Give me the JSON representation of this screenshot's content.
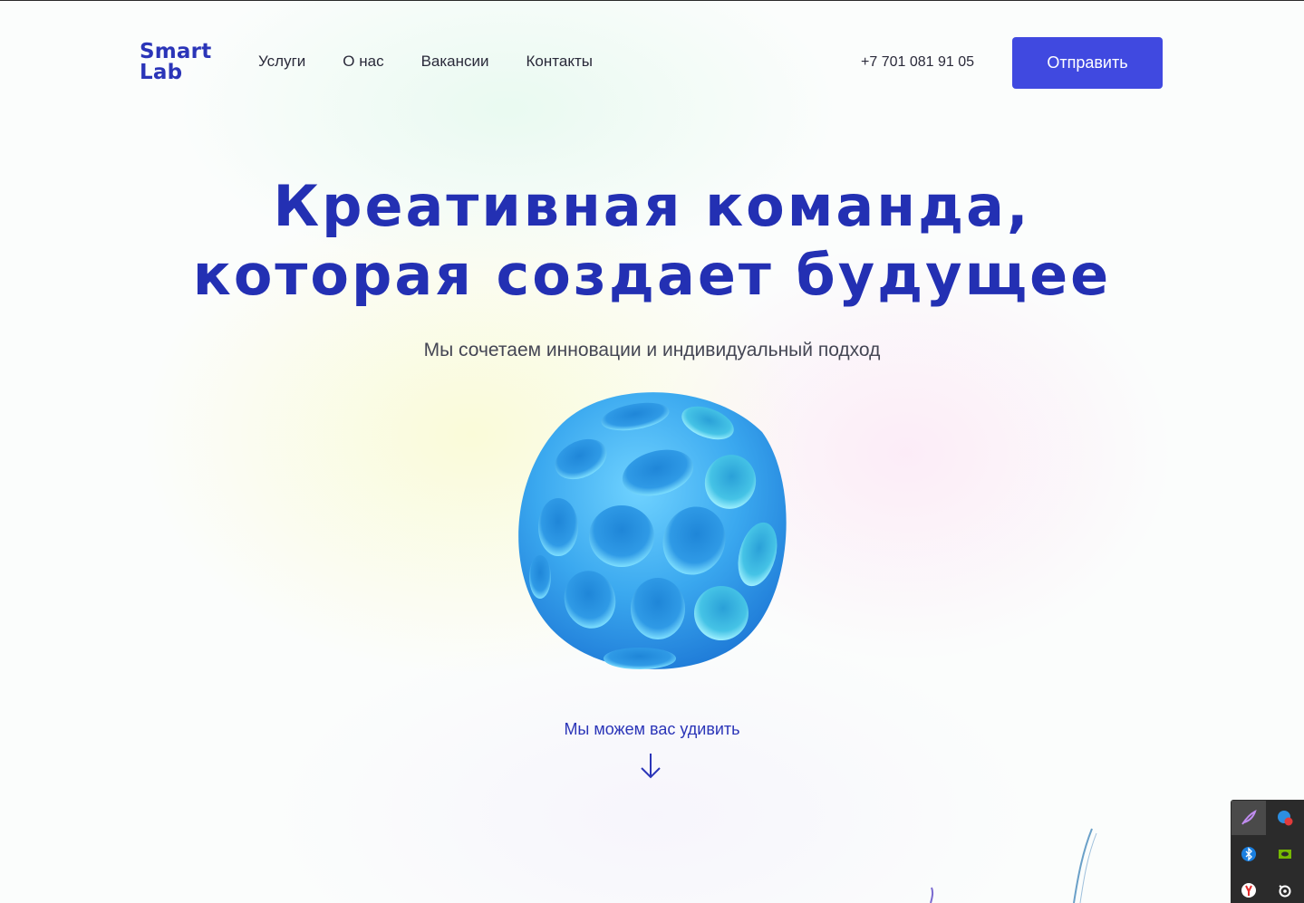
{
  "header": {
    "logo_line1": "Smart",
    "logo_line2": "Lab",
    "nav": [
      {
        "label": "Услуги"
      },
      {
        "label": "О нас"
      },
      {
        "label": "Вакансии"
      },
      {
        "label": "Контакты"
      }
    ],
    "phone": "+7 701 081 91 05",
    "send_label": "Отправить"
  },
  "hero": {
    "title_line1": "Креативная команда,",
    "title_line2": "которая создает будущее",
    "subtitle": "Мы сочетаем инновации и индивидуальный подход",
    "sphere_icon": "blue-perforated-sphere",
    "cta": "Мы можем вас удивить",
    "cta_icon": "arrow-down-icon"
  },
  "tray": {
    "icons": [
      "feather-icon",
      "browser-badge-icon",
      "bluetooth-icon",
      "nvidia-icon",
      "yandex-icon",
      "steelseries-icon"
    ]
  },
  "colors": {
    "brand": "#2b35b8",
    "button": "#4049e0",
    "text": "#2a2a3a",
    "sphere": "#3aa8ef"
  }
}
